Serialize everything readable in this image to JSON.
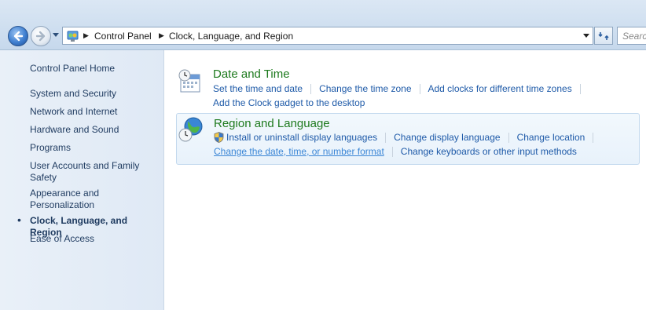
{
  "address_bar": {
    "crumbs": [
      "Control Panel",
      "Clock, Language, and Region"
    ],
    "search_placeholder": "Search"
  },
  "left_nav": {
    "items": [
      {
        "label": "Control Panel Home"
      },
      {
        "label": "System and Security"
      },
      {
        "label": "Network and Internet"
      },
      {
        "label": "Hardware and Sound"
      },
      {
        "label": "Programs"
      },
      {
        "label": "User Accounts and Family Safety"
      },
      {
        "label": "Appearance and Personalization"
      },
      {
        "label": "Clock, Language, and Region",
        "current": true
      },
      {
        "label": "Ease of Access"
      }
    ]
  },
  "sections": [
    {
      "title": "Date and Time",
      "icon": "calendar-clock-icon",
      "links": [
        "Set the time and date",
        "Change the time zone",
        "Add clocks for different time zones",
        "Add the Clock gadget to the desktop"
      ]
    },
    {
      "title": "Region and Language",
      "icon": "globe-clock-icon",
      "links": [
        "Install or uninstall display languages",
        "Change display language",
        "Change location",
        "Change the date, time, or number format",
        "Change keyboards or other input methods"
      ]
    }
  ],
  "colors": {
    "section_title": "#1e7a1e",
    "link": "#1e5aa8",
    "hover_link": "#3b86d6",
    "nav_text": "#1e3a5f"
  }
}
